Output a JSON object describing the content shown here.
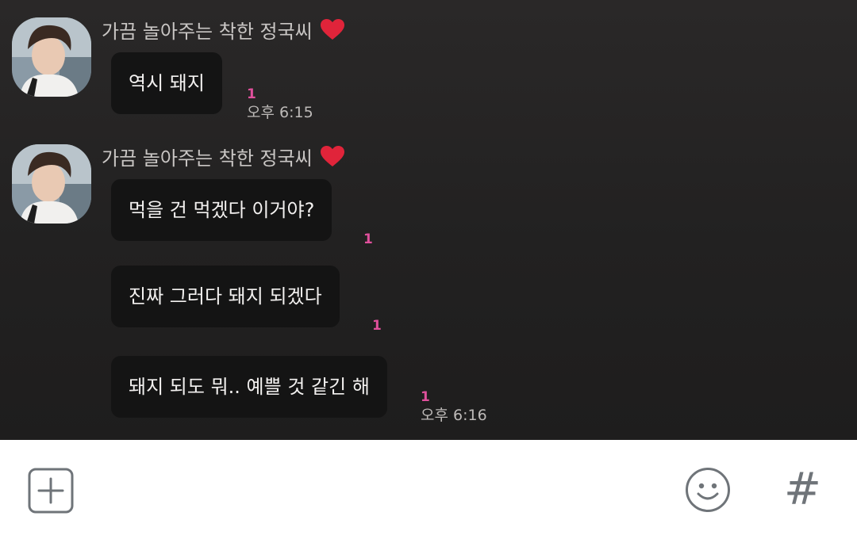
{
  "messages": {
    "group1": {
      "sender": "가끔 놀아주는 착한 정국씨",
      "bubbles": [
        {
          "text": "역시 돼지",
          "unread": "1",
          "time": "오후 6:15"
        }
      ]
    },
    "group2": {
      "sender": "가끔 놀아주는 착한 정국씨",
      "bubbles": [
        {
          "text": "먹을 건 먹겠다 이거야?",
          "unread": "1"
        },
        {
          "text": "진짜 그러다 돼지 되겠다",
          "unread": "1"
        },
        {
          "text": "돼지 되도 뭐.. 예쁠 것 같긴 해",
          "unread": "1",
          "time": "오후 6:16"
        }
      ]
    }
  },
  "input_bar": {
    "add_icon": "plus-box-icon",
    "emoji_icon": "smiley-icon",
    "hash_label": "#"
  },
  "colors": {
    "chat_background": "#242323",
    "bubble": "#141414",
    "bubble_text": "#f3f1f0",
    "sender_text": "#c9c6c4",
    "unread_count": "#e0509c",
    "time_text": "#bdbab8",
    "heart": "#e0243a",
    "input_bar_background": "#ffffff",
    "input_icons": "#6f7479"
  }
}
